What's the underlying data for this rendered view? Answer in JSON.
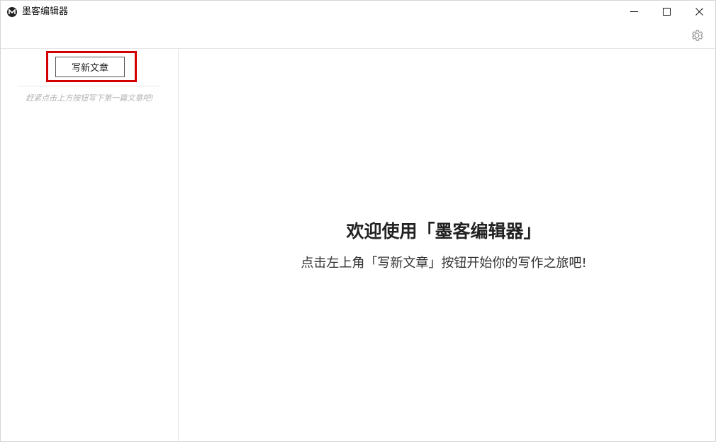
{
  "window": {
    "title": "墨客编辑器"
  },
  "sidebar": {
    "new_article_label": "写新文章",
    "empty_hint": "赶紧点击上方按钮写下第一篇文章吧!"
  },
  "main": {
    "welcome_title": "欢迎使用「墨客编辑器」",
    "welcome_subtitle": "点击左上角「写新文章」按钮开始你的写作之旅吧!"
  },
  "icons": {
    "logo": "app-logo-icon",
    "minimize": "minimize-icon",
    "maximize": "maximize-icon",
    "close": "close-icon",
    "settings": "gear-icon"
  },
  "colors": {
    "highlight": "#d40000",
    "hint_text": "#b3b3b3",
    "divider": "#e6e6e6"
  }
}
